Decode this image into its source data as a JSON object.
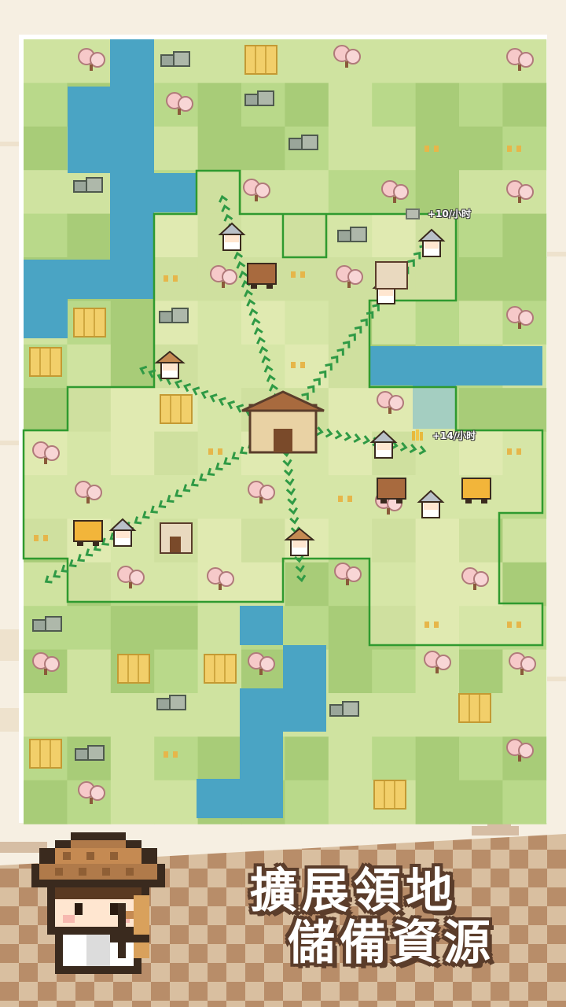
{
  "promo": {
    "headline_line1": "擴展領地",
    "headline_line2": "儲備資源"
  },
  "map": {
    "resource_labels": [
      {
        "text": "+10/小时",
        "icon": "stone-icon"
      },
      {
        "text": "+14/小时",
        "icon": "wheat-icon"
      }
    ]
  },
  "colors": {
    "grass_light": "#cfe3a0",
    "grass_mid": "#b9d98a",
    "grass_dark": "#a8cc78",
    "territory": "#eef0c0",
    "water": "#4aa4c4",
    "border": "#2f9a2f",
    "chevron": "#2f9a45",
    "outline_brown": "#5b3d2b",
    "background": "#f6efe2",
    "checker_light": "#d9bfa0",
    "checker_dark": "#b88d69"
  }
}
